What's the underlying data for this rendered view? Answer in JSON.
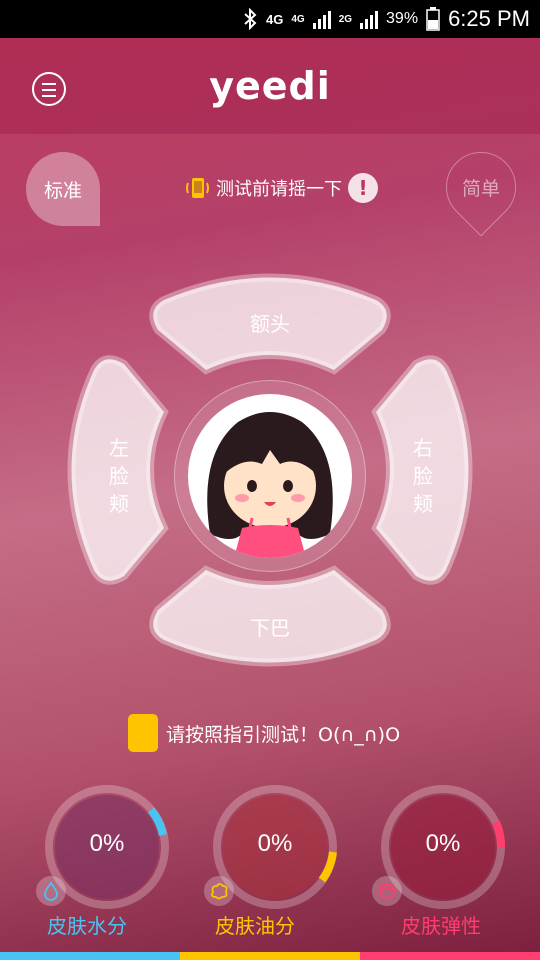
{
  "status_bar": {
    "network_1": "4G",
    "network_2": "4G",
    "network_3": "2G",
    "battery_percent": "39%",
    "time": "6:25 PM"
  },
  "app": {
    "logo_text": "yeedi",
    "menu_icon": "hamburger-icon"
  },
  "modes": {
    "standard_label": "标准",
    "simple_label": "简单"
  },
  "shake_tip": {
    "text": "测试前请摇一下",
    "warn_symbol": "!"
  },
  "zones": {
    "forehead": "额头",
    "left_cheek": [
      "左",
      "脸",
      "颊"
    ],
    "right_cheek": [
      "右",
      "脸",
      "颊"
    ],
    "chin": "下巴"
  },
  "guide": {
    "text": "请按照指引测试！O(∩_∩)O"
  },
  "gauges": [
    {
      "value": "0%",
      "label": "皮肤水分",
      "accent": "#49c4f2",
      "icon": "water-drop-icon"
    },
    {
      "value": "0%",
      "label": "皮肤油分",
      "accent": "#ffc400",
      "icon": "oil-icon"
    },
    {
      "value": "0%",
      "label": "皮肤弹性",
      "accent": "#ff3d6e",
      "icon": "elasticity-icon"
    }
  ],
  "colors": {
    "accent_yellow": "#ffc400",
    "accent_blue": "#49c4f2",
    "accent_pink": "#ff3d6e"
  }
}
